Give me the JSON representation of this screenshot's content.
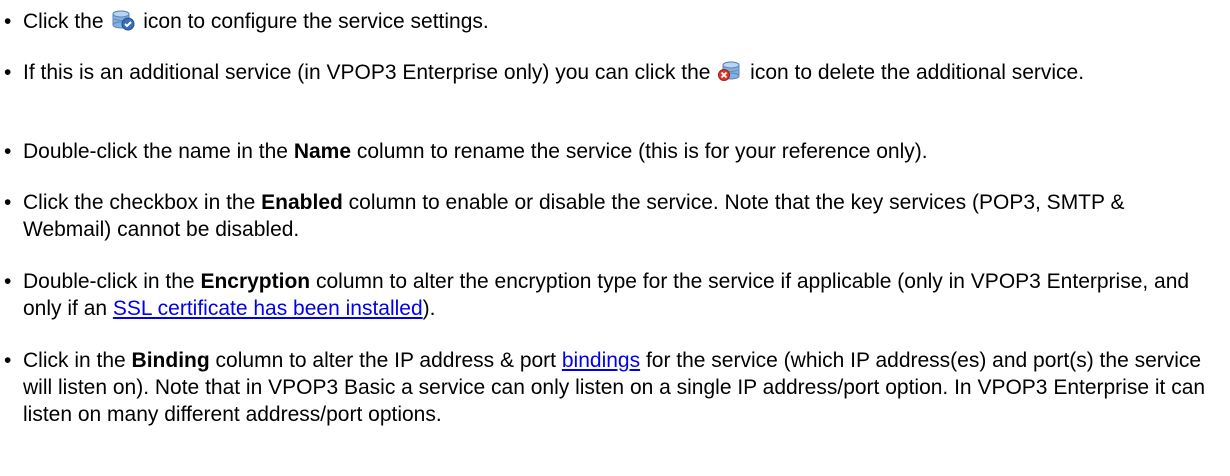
{
  "bullets": [
    {
      "before_icon": "Click the",
      "icon": "database-configure-icon",
      "after_icon": "icon to configure the service settings."
    },
    {
      "before_icon": "If this is an additional service (in VPOP3 Enterprise only) you can click the",
      "icon": "database-delete-icon",
      "after_icon": "icon to delete the additional service."
    },
    {
      "before_bold": "Double-click the name in the",
      "bold": "Name",
      "after_bold": "column to rename the service (this is for your reference only)."
    },
    {
      "before_bold": "Click the checkbox in the",
      "bold": "Enabled",
      "after_bold": "column to enable or disable the service. Note that the key services (POP3, SMTP & Webmail) cannot be disabled."
    },
    {
      "before_bold": "Double-click in the",
      "bold": "Encryption",
      "middle": "column to alter the encryption type for the service if applicable (only in VPOP3 Enterprise, and only if an",
      "link": "SSL certificate has been installed",
      "after_link": ")."
    },
    {
      "before_bold": "Click in the",
      "bold": "Binding",
      "middle": "column to alter the IP address & port",
      "link": "bindings",
      "after_link": "for the service (which IP address(es) and port(s) the service will listen on). Note that in VPOP3 Basic a service can only listen on a single IP address/port option. In VPOP3 Enterprise it can listen on many different address/port options."
    }
  ],
  "colors": {
    "text": "#000000",
    "link": "#0000ee"
  }
}
